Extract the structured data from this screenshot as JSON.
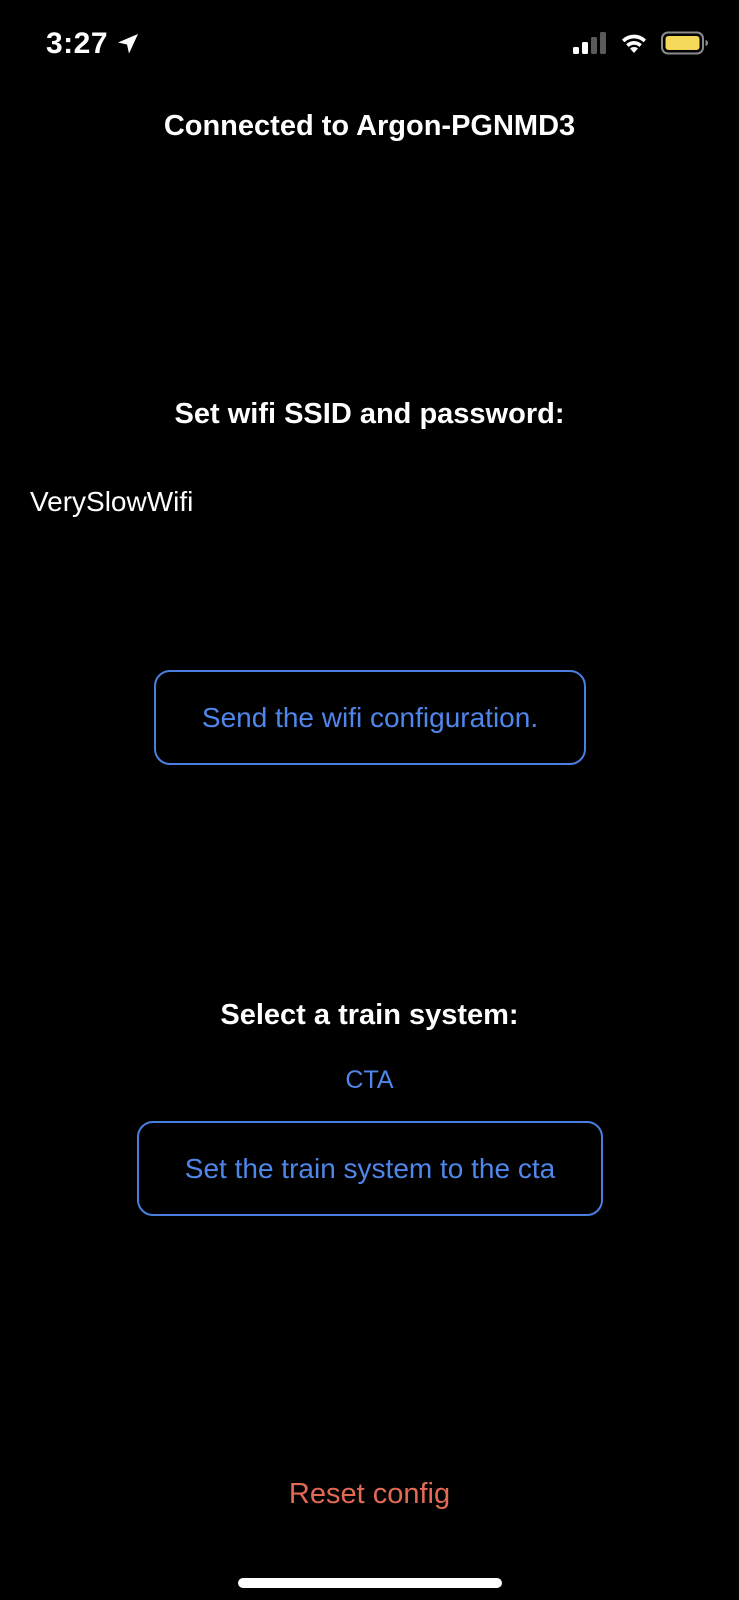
{
  "status_bar": {
    "time": "3:27",
    "location_icon": "location-arrow-icon",
    "signal_icon": "cellular-signal-icon",
    "wifi_icon": "wifi-icon",
    "battery_icon": "battery-icon",
    "battery_color": "#f4d85a"
  },
  "header": {
    "title": "Connected to Argon-PGNMD3"
  },
  "wifi": {
    "heading": "Set wifi SSID and password:",
    "ssid_value": "VerySlowWifi",
    "send_button_label": "Send the wifi configuration."
  },
  "train": {
    "heading": "Select a train system:",
    "selected_system": "CTA",
    "set_button_label": "Set the train system to the cta"
  },
  "footer": {
    "reset_label": "Reset config"
  },
  "colors": {
    "background": "#000000",
    "text": "#ffffff",
    "accent": "#4f86ea",
    "destructive": "#e26a55"
  }
}
